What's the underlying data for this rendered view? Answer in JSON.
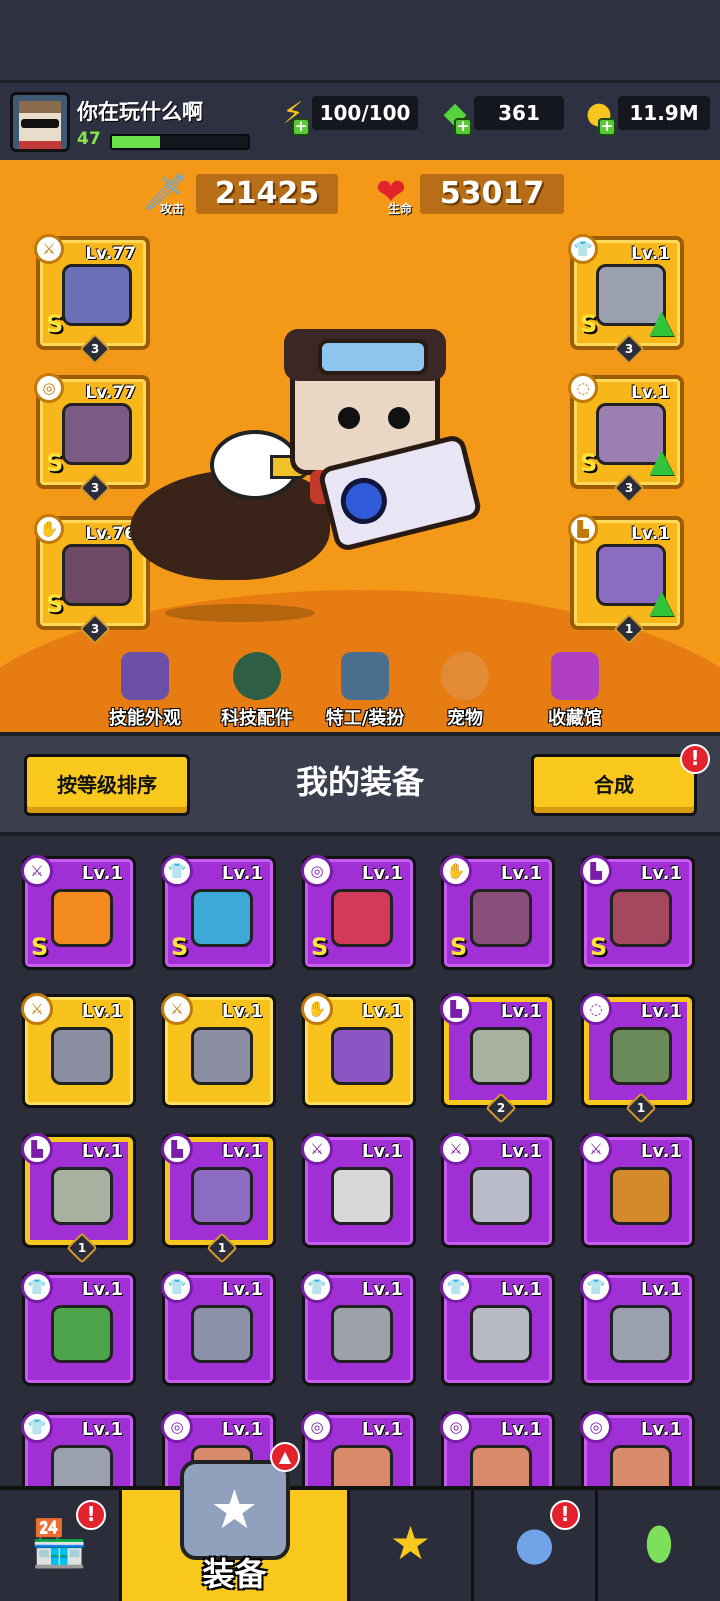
{
  "player": {
    "name": "你在玩什么啊",
    "level": "47",
    "xp_progress": 0.35
  },
  "resources": {
    "energy": "100/100",
    "gems": "361",
    "coins": "11.9M"
  },
  "stats": {
    "attack_value": "21425",
    "attack_label": "攻击",
    "hp_value": "53017",
    "hp_label": "生命"
  },
  "equipped_left": [
    {
      "level": "Lv.77",
      "grade": "S",
      "stars": "3",
      "cat_icon": "weapon-icon",
      "art_color": "#6a6fb8"
    },
    {
      "level": "Lv.77",
      "grade": "S",
      "stars": "3",
      "cat_icon": "necklace-icon",
      "art_color": "#7b5a86"
    },
    {
      "level": "Lv.76",
      "grade": "S",
      "stars": "3",
      "cat_icon": "glove-icon",
      "art_color": "#6f4a66"
    }
  ],
  "equipped_right": [
    {
      "level": "Lv.1",
      "grade": "S",
      "stars": "3",
      "cat_icon": "armor-icon",
      "art_color": "#9aa0b0"
    },
    {
      "level": "Lv.1",
      "grade": "S",
      "stars": "3",
      "cat_icon": "belt-icon",
      "art_color": "#9c7fb0"
    },
    {
      "level": "Lv.1",
      "grade": "",
      "stars": "1",
      "cat_icon": "boot-icon",
      "art_color": "#8b6cc0"
    }
  ],
  "tabs": [
    "技能外观",
    "科技配件",
    "特工/装扮",
    "宠物",
    "收藏馆"
  ],
  "panel": {
    "sort_button": "按等级排序",
    "title": "我的装备",
    "merge_button": "合成",
    "alert": "!"
  },
  "items": [
    {
      "level": "Lv.1",
      "grade": "S",
      "style": "purple",
      "badge": "",
      "cat": "weapon",
      "art_color": "#f28a1e"
    },
    {
      "level": "Lv.1",
      "grade": "S",
      "style": "purple",
      "badge": "",
      "cat": "armor",
      "art_color": "#3ea8d8"
    },
    {
      "level": "Lv.1",
      "grade": "S",
      "style": "purple",
      "badge": "",
      "cat": "necklace",
      "art_color": "#d33a5a"
    },
    {
      "level": "Lv.1",
      "grade": "S",
      "style": "purple",
      "badge": "",
      "cat": "glove",
      "art_color": "#8a4e7a"
    },
    {
      "level": "Lv.1",
      "grade": "S",
      "style": "purple",
      "badge": "",
      "cat": "boot",
      "art_color": "#a3485e"
    },
    {
      "level": "Lv.1",
      "grade": "",
      "style": "gold",
      "badge": "",
      "cat": "weapon",
      "art_color": "#8c8fa2"
    },
    {
      "level": "Lv.1",
      "grade": "",
      "style": "gold",
      "badge": "",
      "cat": "weapon",
      "art_color": "#8c8fa2"
    },
    {
      "level": "Lv.1",
      "grade": "",
      "style": "gold",
      "badge": "",
      "cat": "glove",
      "art_color": "#8d55c4"
    },
    {
      "level": "Lv.1",
      "grade": "",
      "style": "purple framed",
      "badge": "2",
      "cat": "boot",
      "art_color": "#a8b1a0"
    },
    {
      "level": "Lv.1",
      "grade": "",
      "style": "purple framed",
      "badge": "1",
      "cat": "belt",
      "art_color": "#6a8a5a"
    },
    {
      "level": "Lv.1",
      "grade": "",
      "style": "purple framed",
      "badge": "1",
      "cat": "boot",
      "art_color": "#a8b1a0"
    },
    {
      "level": "Lv.1",
      "grade": "",
      "style": "purple framed",
      "badge": "1",
      "cat": "boot",
      "art_color": "#8b6cc0"
    },
    {
      "level": "Lv.1",
      "grade": "",
      "style": "purple",
      "badge": "",
      "cat": "weapon",
      "art_color": "#d8d8d8"
    },
    {
      "level": "Lv.1",
      "grade": "",
      "style": "purple",
      "badge": "",
      "cat": "weapon",
      "art_color": "#b9bcc8"
    },
    {
      "level": "Lv.1",
      "grade": "",
      "style": "purple",
      "badge": "",
      "cat": "weapon",
      "art_color": "#d48a2a"
    },
    {
      "level": "Lv.1",
      "grade": "",
      "style": "purple",
      "badge": "",
      "cat": "armor",
      "art_color": "#4da44a"
    },
    {
      "level": "Lv.1",
      "grade": "",
      "style": "purple",
      "badge": "",
      "cat": "armor",
      "art_color": "#8b91a8"
    },
    {
      "level": "Lv.1",
      "grade": "",
      "style": "purple",
      "badge": "",
      "cat": "armor",
      "art_color": "#9da1a8"
    },
    {
      "level": "Lv.1",
      "grade": "",
      "style": "purple",
      "badge": "",
      "cat": "armor",
      "art_color": "#b7bac2"
    },
    {
      "level": "Lv.1",
      "grade": "",
      "style": "purple",
      "badge": "",
      "cat": "armor",
      "art_color": "#9aa0ad"
    },
    {
      "level": "Lv.1",
      "grade": "",
      "style": "purple",
      "badge": "",
      "cat": "armor",
      "art_color": "#9aa0ad"
    },
    {
      "level": "Lv.1",
      "grade": "",
      "style": "purple",
      "badge": "",
      "cat": "necklace",
      "art_color": "#d98a6a"
    },
    {
      "level": "Lv.1",
      "grade": "",
      "style": "purple",
      "badge": "",
      "cat": "necklace",
      "art_color": "#d98a6a"
    },
    {
      "level": "Lv.1",
      "grade": "",
      "style": "purple",
      "badge": "",
      "cat": "necklace",
      "art_color": "#d98a6a"
    },
    {
      "level": "Lv.1",
      "grade": "",
      "style": "purple",
      "badge": "",
      "cat": "necklace",
      "art_color": "#d98a6a"
    }
  ],
  "bottom_nav": {
    "active_label": "装备",
    "alert": "!"
  },
  "colors": {
    "arena": "#f39817",
    "item_purple": "#a12fd6",
    "item_gold": "#f7c21c",
    "button_yellow": "#f8c81d",
    "alert_red": "#e3222e"
  }
}
